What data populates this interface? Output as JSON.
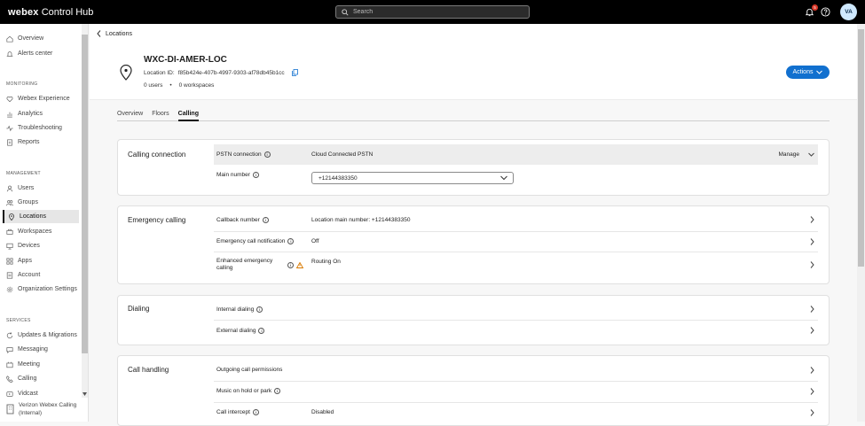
{
  "app": {
    "brand_bold": "webex",
    "brand_rest": "Control Hub"
  },
  "search": {
    "placeholder": "Search"
  },
  "notifications": {
    "count": "5"
  },
  "user": {
    "initials": "VA"
  },
  "sidebar": {
    "top_items": [
      {
        "label": "Overview",
        "icon": "home-icon"
      },
      {
        "label": "Alerts center",
        "icon": "bell-icon"
      }
    ],
    "sections": [
      {
        "title": "MONITORING",
        "items": [
          {
            "label": "Webex Experience",
            "icon": "heart-icon"
          },
          {
            "label": "Analytics",
            "icon": "analytics-icon"
          },
          {
            "label": "Troubleshooting",
            "icon": "pulse-icon"
          },
          {
            "label": "Reports",
            "icon": "report-icon"
          }
        ]
      },
      {
        "title": "MANAGEMENT",
        "items": [
          {
            "label": "Users",
            "icon": "user-icon"
          },
          {
            "label": "Groups",
            "icon": "group-icon"
          },
          {
            "label": "Locations",
            "icon": "location-icon",
            "active": true
          },
          {
            "label": "Workspaces",
            "icon": "workspace-icon"
          },
          {
            "label": "Devices",
            "icon": "device-icon"
          },
          {
            "label": "Apps",
            "icon": "apps-icon"
          },
          {
            "label": "Account",
            "icon": "account-icon"
          },
          {
            "label": "Organization Settings",
            "icon": "settings-icon"
          }
        ]
      },
      {
        "title": "SERVICES",
        "items": [
          {
            "label": "Updates & Migrations",
            "icon": "refresh-icon"
          },
          {
            "label": "Messaging",
            "icon": "chat-icon"
          },
          {
            "label": "Meeting",
            "icon": "meeting-icon"
          },
          {
            "label": "Calling",
            "icon": "phone-icon"
          },
          {
            "label": "Vidcast",
            "icon": "vidcast-icon"
          }
        ]
      }
    ],
    "footer": {
      "line1": "Verizon Webex Calling",
      "line2": "(Internal)"
    }
  },
  "header": {
    "breadcrumb": "Locations",
    "title": "WXC-DI-AMER-LOC",
    "location_id_label": "Location ID:",
    "location_id": "f85b424e-407b-4997-9303-af78db45b1cc",
    "users": "0 users",
    "bullet": "•",
    "workspaces": "0 workspaces",
    "actions_label": "Actions"
  },
  "tabs": [
    {
      "label": "Overview"
    },
    {
      "label": "Floors"
    },
    {
      "label": "Calling",
      "active": true
    }
  ],
  "cards": {
    "calling_connection": {
      "title": "Calling connection",
      "pstn_label": "PSTN connection",
      "pstn_value": "Cloud Connected PSTN",
      "manage": "Manage",
      "main_number_label": "Main number",
      "main_number_value": "+12144383350"
    },
    "emergency": {
      "title": "Emergency calling",
      "callback_label": "Callback number",
      "callback_value": "Location main number: +12144383350",
      "notification_label": "Emergency call notification",
      "notification_value": "Off",
      "enhanced_label_1": "Enhanced emergency",
      "enhanced_label_2": "calling",
      "enhanced_value": "Routing On"
    },
    "dialing": {
      "title": "Dialing",
      "internal_label": "Internal dialing",
      "external_label": "External dialing"
    },
    "call_handling": {
      "title": "Call handling",
      "outgoing_label": "Outgoing call permissions",
      "moh_label": "Music on hold or park",
      "intercept_label": "Call intercept",
      "intercept_value": "Disabled"
    }
  },
  "colors": {
    "topbar": "#000000",
    "accent": "#1170cf",
    "warning": "#d97a00",
    "badge": "#d93829"
  }
}
